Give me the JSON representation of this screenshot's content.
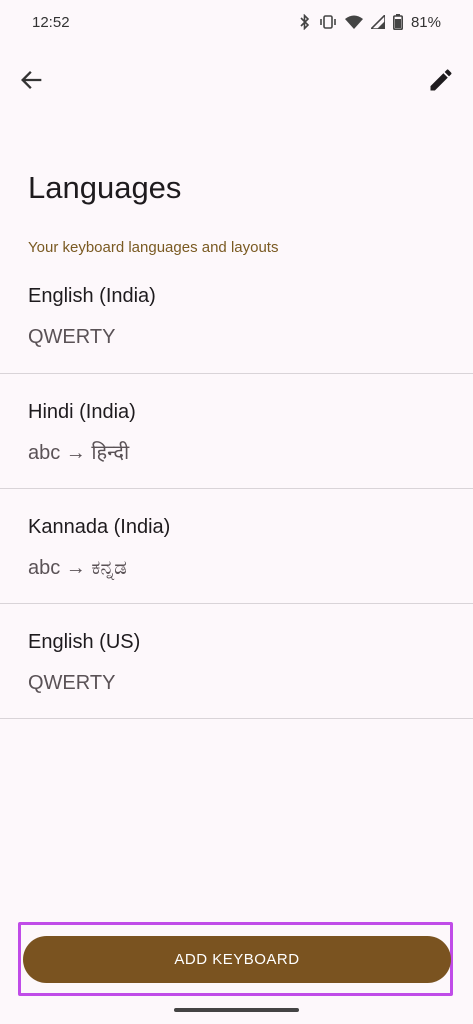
{
  "status_bar": {
    "time": "12:52",
    "battery": "81%",
    "icons": [
      "bluetooth-icon",
      "vibrate-icon",
      "wifi-icon",
      "signal-icon",
      "battery-icon"
    ]
  },
  "toolbar": {
    "back_icon": "arrow-back-icon",
    "edit_icon": "pencil-icon"
  },
  "page": {
    "title": "Languages",
    "section_header": "Your keyboard languages and layouts"
  },
  "languages": [
    {
      "name": "English (India)",
      "layout": "QWERTY"
    },
    {
      "name": "Hindi (India)",
      "layout": "abc → हिन्दी"
    },
    {
      "name": "Kannada (India)",
      "layout": "abc → ಕನ್ನಡ"
    },
    {
      "name": "English (US)",
      "layout": "QWERTY"
    }
  ],
  "footer": {
    "add_keyboard_label": "ADD KEYBOARD"
  },
  "colors": {
    "background": "#fdf8fb",
    "accent": "#7a5320",
    "section_header": "#7a5a22",
    "highlight": "#c04ce8"
  }
}
